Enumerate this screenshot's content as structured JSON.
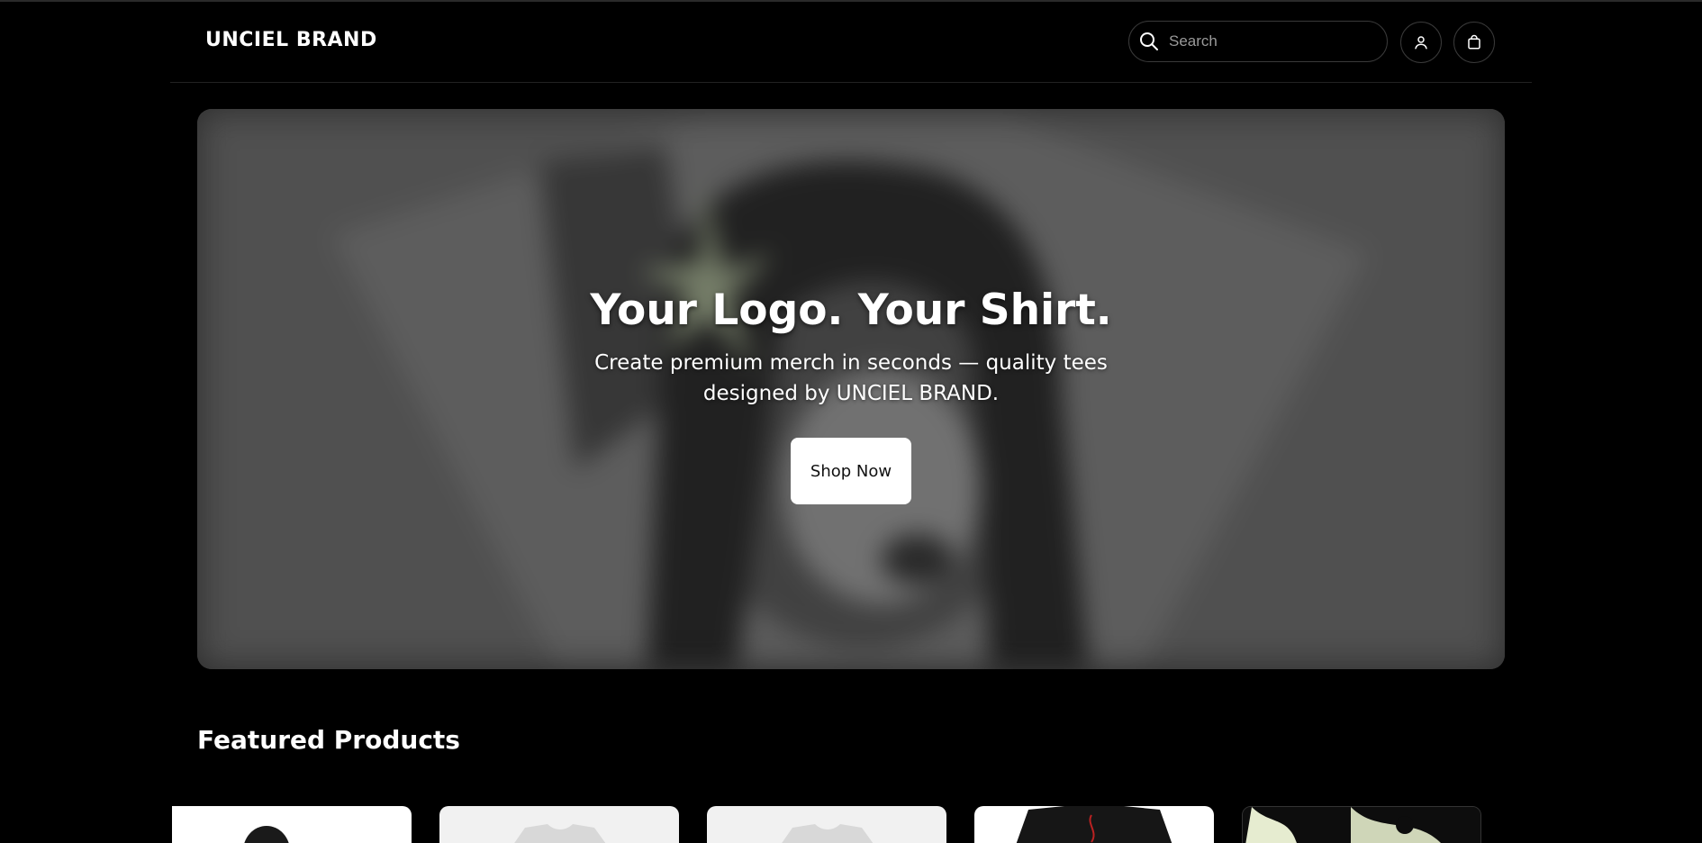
{
  "header": {
    "brand": "UNCIEL BRAND",
    "search_placeholder": "Search",
    "account_icon": "user-icon",
    "cart_icon": "shopping-bag-icon"
  },
  "hero": {
    "title": "Your Logo. Your Shirt.",
    "subtitle": "Create premium merch in seconds — quality tees designed by UNCIEL BRAND.",
    "cta_label": "Shop Now"
  },
  "featured": {
    "title": "Featured Products",
    "products": [
      {
        "image": "black-hoodie-image"
      },
      {
        "image": "white-tshirt-image"
      },
      {
        "image": "white-tshirt-image"
      },
      {
        "image": "black-printed-tshirt-image"
      },
      {
        "image": "graphic-print-tshirt-image"
      }
    ]
  },
  "colors": {
    "background": "#000000",
    "button_bg": "#ffffff",
    "text": "#ffffff"
  }
}
